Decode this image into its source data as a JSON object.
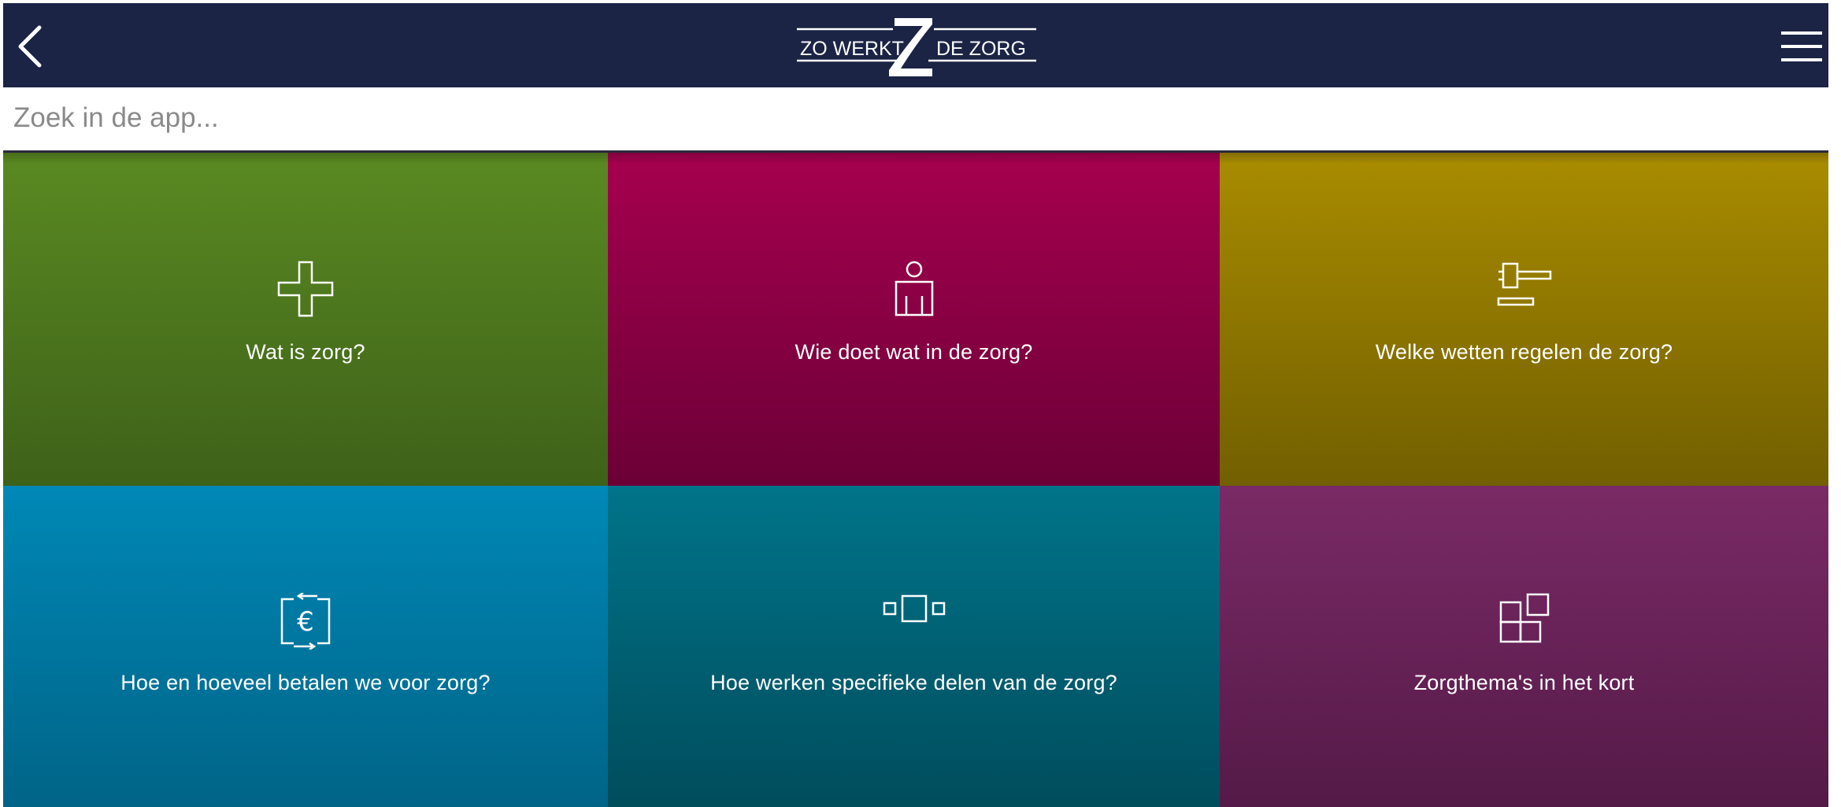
{
  "header": {
    "logo_left": "ZO WERKT",
    "logo_right": "DE ZORG",
    "back_icon": "chevron-left-icon",
    "menu_icon": "hamburger-menu-icon",
    "background": "#1b2445"
  },
  "search": {
    "placeholder": "Zoek in de app..."
  },
  "tiles": [
    {
      "label": "Wat is zorg?",
      "icon": "medical-cross-icon",
      "color": "#5a8a22"
    },
    {
      "label": "Wie doet wat in de zorg?",
      "icon": "person-icon",
      "color": "#a6004f"
    },
    {
      "label": "Welke wetten regelen de zorg?",
      "icon": "gavel-icon",
      "color": "#a98c00"
    },
    {
      "label": "Hoe en hoeveel betalen we voor zorg?",
      "icon": "euro-exchange-icon",
      "color": "#0088b6"
    },
    {
      "label": "Hoe werken specifieke delen van de zorg?",
      "icon": "parts-boxes-icon",
      "color": "#00748a"
    },
    {
      "label": "Zorgthema's in het kort",
      "icon": "tiles-icon",
      "color": "#7a2a66"
    }
  ]
}
